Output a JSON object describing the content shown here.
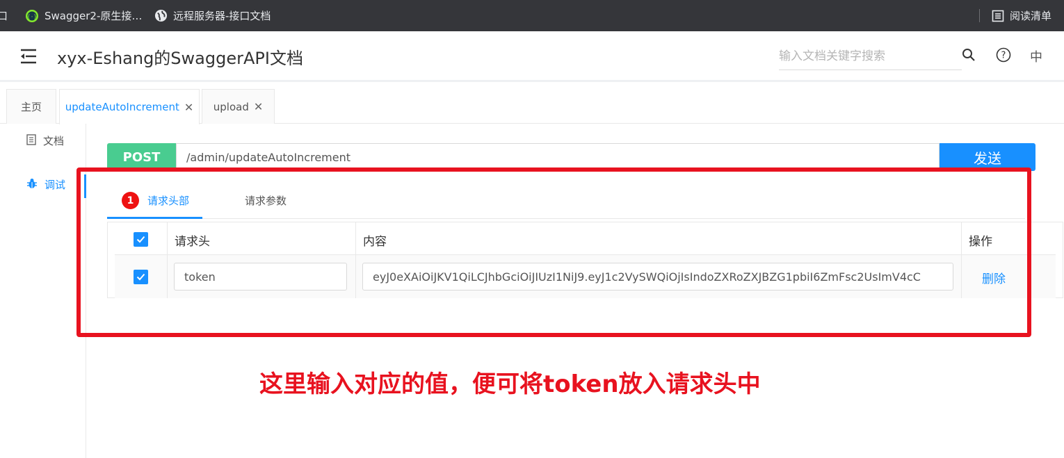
{
  "bookmarks": {
    "items": [
      {
        "label": "口",
        "icon": "none"
      },
      {
        "label": "Swagger2-原生接…",
        "icon": "swagger-logo-icon"
      },
      {
        "label": "远程服务器-接口文档",
        "icon": "globe-icon"
      }
    ],
    "reading_list": "阅读清单"
  },
  "header": {
    "title": "xyx-Eshang的SwaggerAPI文档",
    "search_placeholder": "输入文档关键字搜索",
    "lang": "中"
  },
  "tabs": [
    {
      "label": "主页",
      "closable": false
    },
    {
      "label": "updateAutoIncrement",
      "closable": true,
      "active": true
    },
    {
      "label": "upload",
      "closable": true
    }
  ],
  "side_menu": [
    {
      "label": "文档",
      "icon": "document-icon"
    },
    {
      "label": "调试",
      "icon": "bug-icon",
      "active": true
    }
  ],
  "request": {
    "method": "POST",
    "url": "/admin/updateAutoIncrement",
    "send_label": "发送"
  },
  "inner_tabs": [
    {
      "label": "请求头部",
      "badge": "1",
      "active": true
    },
    {
      "label": "请求参数"
    }
  ],
  "headers_table": {
    "columns": [
      "请求头",
      "内容",
      "操作"
    ],
    "rows": [
      {
        "checked": true,
        "name": "token",
        "value": "eyJ0eXAiOiJKV1QiLCJhbGciOiJIUzI1NiJ9.eyJ1c2VySWQiOjIsIndoZXRoZXJBZG1pbiI6ZmFsc2UsImV4cC",
        "action": "删除"
      }
    ]
  },
  "annotation": {
    "text": "这里输入对应的值，便可将token放入请求头中",
    "color": "#e8121f"
  },
  "colors": {
    "accent": "#1890ff",
    "post": "#49cc90"
  }
}
